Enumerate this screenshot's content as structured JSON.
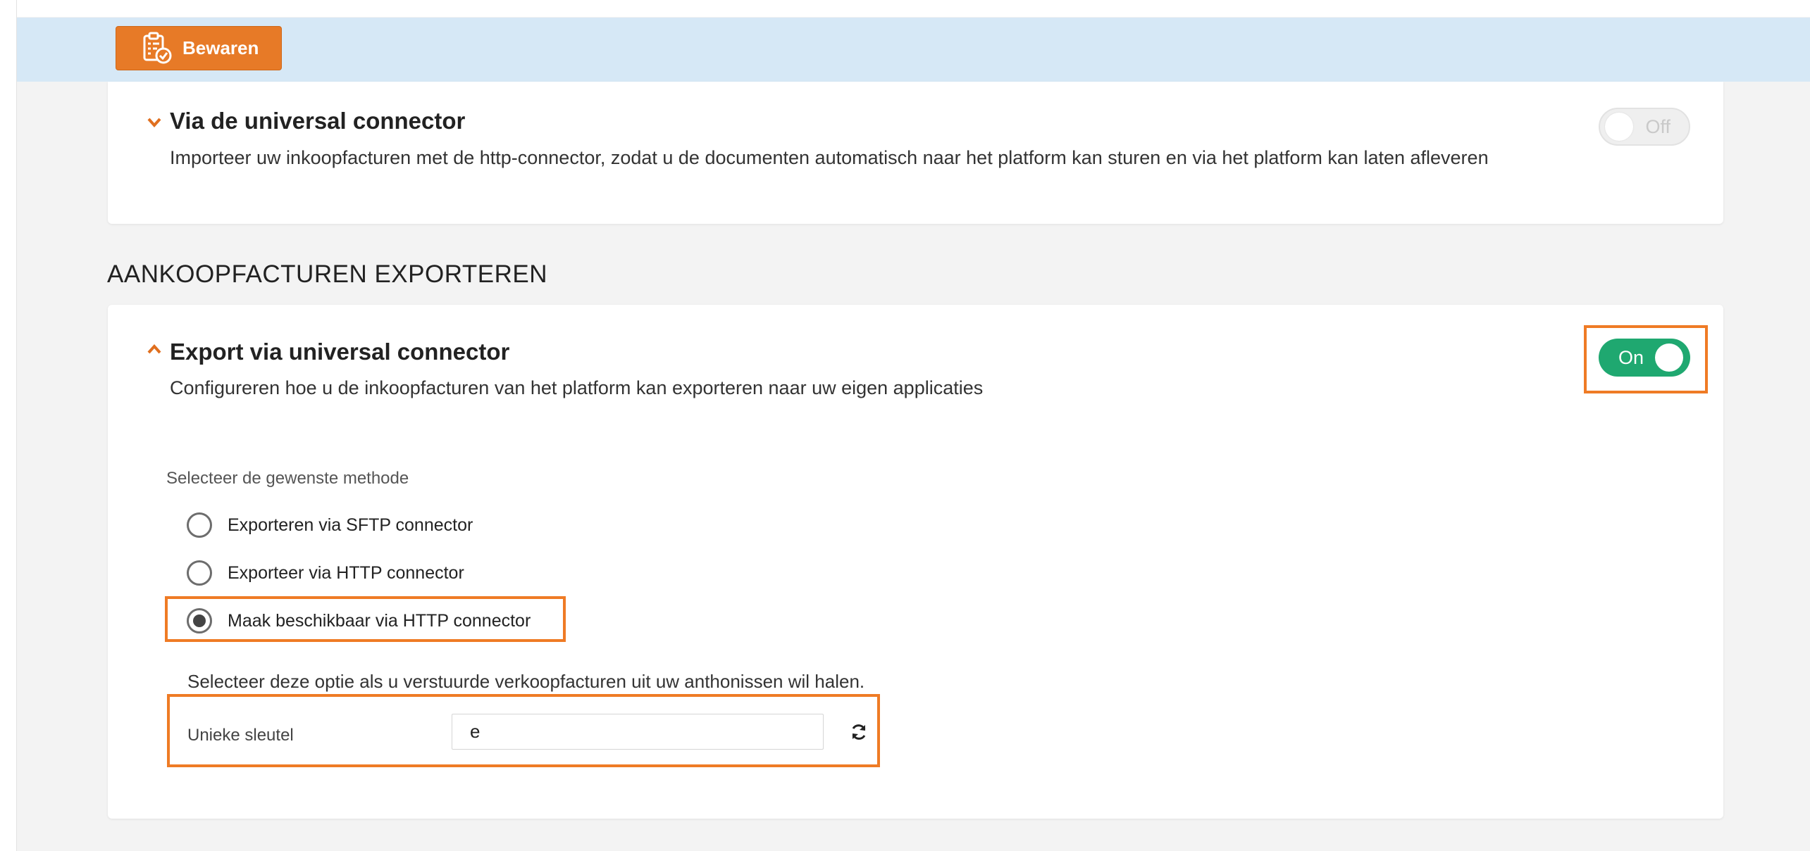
{
  "toolbar": {
    "save_label": "Bewaren"
  },
  "import_section": {
    "title": "Via de universal connector",
    "description": "Importeer uw inkoopfacturen met de http-connector, zodat u de documenten automatisch naar het platform kan sturen en via het platform kan laten afleveren",
    "toggle_label": "Off",
    "toggle_state": "off"
  },
  "export_heading": "AANKOOPFACTUREN EXPORTEREN",
  "export_section": {
    "title": "Export via universal connector",
    "description": "Configureren hoe u de inkoopfacturen van het platform kan exporteren naar uw eigen applicaties",
    "toggle_label": "On",
    "toggle_state": "on",
    "method_label": "Selecteer de gewenste methode",
    "methods": [
      {
        "label": "Exporteren via SFTP connector",
        "checked": false
      },
      {
        "label": "Exporteer via HTTP connector",
        "checked": false
      },
      {
        "label": "Maak beschikbaar via HTTP connector",
        "checked": true
      }
    ],
    "help_text": "Selecteer deze optie als u verstuurde verkoopfacturen uit uw anthonissen wil halen.",
    "key_label": "Unieke sleutel",
    "key_value": "e"
  },
  "colors": {
    "accent_orange": "#e77a27",
    "toggle_on_green": "#1fa870",
    "action_bar_blue": "#d6e8f6",
    "highlight_orange": "#ef7b25"
  },
  "icons": {
    "save": "clipboard-check-icon",
    "collapse": "chevron-down-icon",
    "expand": "chevron-up-icon",
    "refresh": "refresh-icon"
  }
}
